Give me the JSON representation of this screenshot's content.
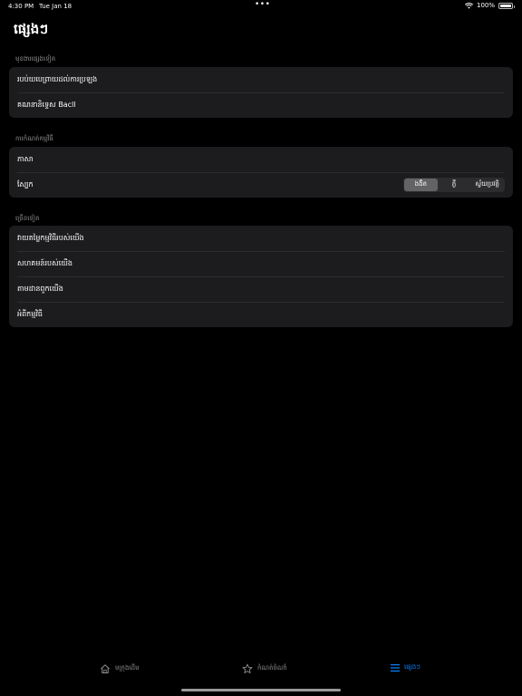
{
  "status_bar": {
    "time": "4:30 PM",
    "date": "Tue Jan 18",
    "battery": "100%"
  },
  "page": {
    "title": "ផ្សេងៗ"
  },
  "sections": [
    {
      "header": "មុខងារផ្សេងទៀត",
      "rows": [
        {
          "label": "របប់យបេព្រាយដល់ការប្រឡង"
        },
        {
          "label": "គណនានិទ្ទេស Bacll"
        }
      ]
    },
    {
      "header": "ការកំណត់កម្មវិធី",
      "rows": [
        {
          "label": "ភាសា"
        },
        {
          "label": "ស្បែក"
        }
      ]
    },
    {
      "header": "ច្រើនទៀត",
      "rows": [
        {
          "label": "វាយតម្លៃកម្មវិធីរបស់យើង"
        },
        {
          "label": "សហគមន៍របស់យើង"
        },
        {
          "label": "តាមដានពួកយើង"
        },
        {
          "label": "អំពីកម្មវិធី"
        }
      ]
    }
  ],
  "theme_selector": {
    "options": [
      "ងងឹត",
      "ភ្លឺ",
      "ស្វ័យប្រវត្តិ"
    ],
    "selected": "ងងឹត"
  },
  "tabbar": {
    "tabs": [
      {
        "label": "មក្រុងដើម",
        "icon": "house-icon",
        "active": false
      },
      {
        "label": "កំណត់ចំណាំ",
        "icon": "star-icon",
        "active": false
      },
      {
        "label": "ផ្សេងៗ",
        "icon": "list-icon",
        "active": true
      }
    ]
  },
  "colors": {
    "background": "#000000",
    "card": "#1c1c1e",
    "accent": "#0a84ff",
    "secondary_text": "#8e8e93"
  }
}
